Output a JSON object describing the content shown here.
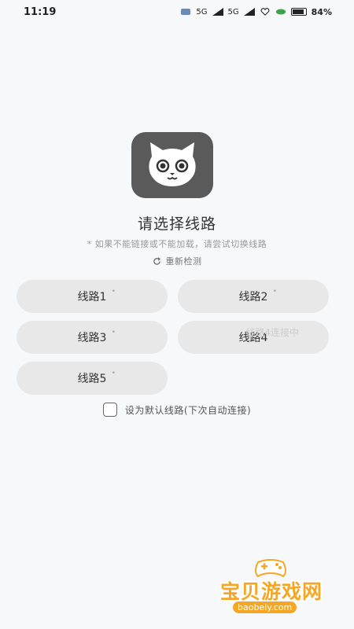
{
  "status_bar": {
    "time": "11:19",
    "network_1": "5G",
    "network_2": "5G",
    "battery": "84%"
  },
  "logo": {
    "icon": "cat-face-icon",
    "background": "#5a5a5a"
  },
  "title": "请选择线路",
  "hint": "* 如果不能链接或不能加载，请尝试切换线路",
  "retry_label": "重新检测",
  "routes": [
    {
      "label": "线路1",
      "status": ""
    },
    {
      "label": "线路2",
      "status": ""
    },
    {
      "label": "线路3",
      "status": ""
    },
    {
      "label": "线路4",
      "status": "线路4连接中"
    },
    {
      "label": "线路5",
      "status": ""
    }
  ],
  "default_checkbox": {
    "label": "设为默认线路(下次自动连接)",
    "checked": false
  },
  "watermark": {
    "name": "宝贝游戏网",
    "url": "baobeiy.com"
  },
  "colors": {
    "button_bg": "#e8e8e8",
    "page_bg": "#f7f8fa",
    "watermark": "#f5a623"
  }
}
